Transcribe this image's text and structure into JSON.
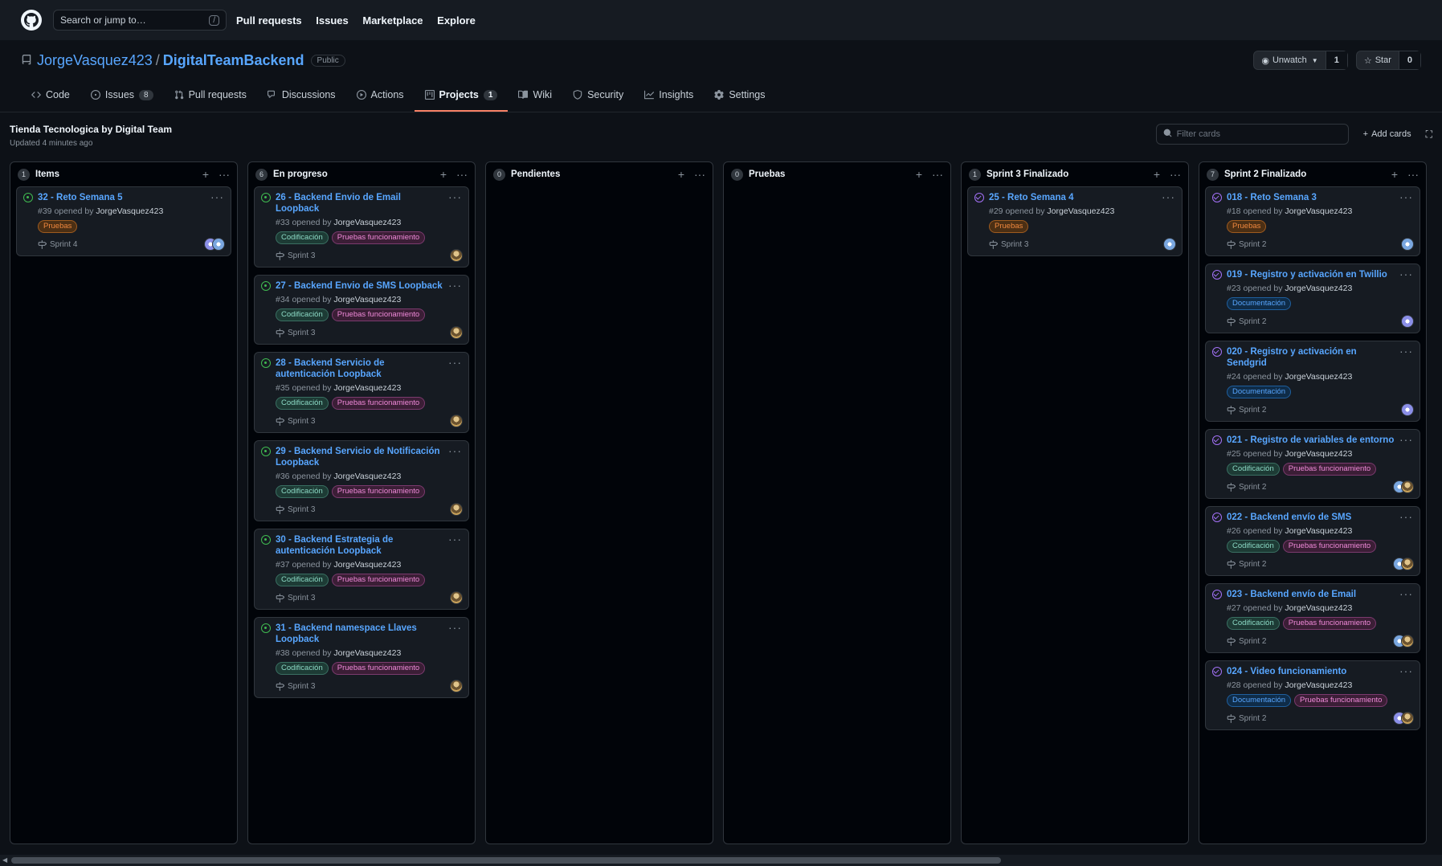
{
  "topbar": {
    "search_placeholder": "Search or jump to…",
    "search_key": "/",
    "nav": [
      "Pull requests",
      "Issues",
      "Marketplace",
      "Explore"
    ]
  },
  "repo": {
    "owner": "JorgeVasquez423",
    "name": "DigitalTeamBackend",
    "visibility": "Public",
    "watch_label": "Unwatch",
    "watch_count": "1",
    "star_label": "Star",
    "star_count": "0"
  },
  "tabs": [
    {
      "label": "Code",
      "icon": "code-icon"
    },
    {
      "label": "Issues",
      "icon": "issue-icon",
      "count": "8"
    },
    {
      "label": "Pull requests",
      "icon": "pull-request-icon"
    },
    {
      "label": "Discussions",
      "icon": "discussion-icon"
    },
    {
      "label": "Actions",
      "icon": "play-icon"
    },
    {
      "label": "Projects",
      "icon": "project-icon",
      "count": "1",
      "active": true
    },
    {
      "label": "Wiki",
      "icon": "book-icon"
    },
    {
      "label": "Security",
      "icon": "shield-icon"
    },
    {
      "label": "Insights",
      "icon": "graph-icon"
    },
    {
      "label": "Settings",
      "icon": "gear-icon"
    }
  ],
  "project": {
    "title": "Tienda Tecnologica by Digital Team",
    "updated": "Updated 4 minutes ago",
    "filter_placeholder": "Filter cards",
    "add_cards": "Add cards"
  },
  "columns": [
    {
      "name": "Items",
      "count": "1",
      "cards": [
        {
          "title": "32 - Reto Semana 5",
          "number": "#39",
          "opened_by": "opened by",
          "user": "JorgeVasquez423",
          "labels": [
            {
              "text": "Pruebas",
              "color": "orange"
            }
          ],
          "milestone": "Sprint 4",
          "state": "open",
          "avatars": [
            "purple",
            "blue"
          ]
        }
      ]
    },
    {
      "name": "En progreso",
      "count": "6",
      "cards": [
        {
          "title": "26 - Backend Envio de Email Loopback",
          "number": "#33",
          "opened_by": "opened by",
          "user": "JorgeVasquez423",
          "labels": [
            {
              "text": "Codificación",
              "color": "green"
            },
            {
              "text": "Pruebas funcionamiento",
              "color": "pink"
            }
          ],
          "milestone": "Sprint 3",
          "state": "open",
          "avatars": [
            "gold"
          ]
        },
        {
          "title": "27 - Backend Envio de SMS Loopback",
          "number": "#34",
          "opened_by": "opened by",
          "user": "JorgeVasquez423",
          "labels": [
            {
              "text": "Codificación",
              "color": "green"
            },
            {
              "text": "Pruebas funcionamiento",
              "color": "pink"
            }
          ],
          "milestone": "Sprint 3",
          "state": "open",
          "avatars": [
            "gold"
          ]
        },
        {
          "title": "28 - Backend Servicio de autenticación Loopback",
          "number": "#35",
          "opened_by": "opened by",
          "user": "JorgeVasquez423",
          "labels": [
            {
              "text": "Codificación",
              "color": "green"
            },
            {
              "text": "Pruebas funcionamiento",
              "color": "pink"
            }
          ],
          "milestone": "Sprint 3",
          "state": "open",
          "avatars": [
            "gold"
          ]
        },
        {
          "title": "29 - Backend Servicio de Notificación Loopback",
          "number": "#36",
          "opened_by": "opened by",
          "user": "JorgeVasquez423",
          "labels": [
            {
              "text": "Codificación",
              "color": "green"
            },
            {
              "text": "Pruebas funcionamiento",
              "color": "pink"
            }
          ],
          "milestone": "Sprint 3",
          "state": "open",
          "avatars": [
            "gold"
          ]
        },
        {
          "title": "30 - Backend Estrategia de autenticación Loopback",
          "number": "#37",
          "opened_by": "opened by",
          "user": "JorgeVasquez423",
          "labels": [
            {
              "text": "Codificación",
              "color": "green"
            },
            {
              "text": "Pruebas funcionamiento",
              "color": "pink"
            }
          ],
          "milestone": "Sprint 3",
          "state": "open",
          "avatars": [
            "gold"
          ]
        },
        {
          "title": "31 - Backend namespace Llaves Loopback",
          "number": "#38",
          "opened_by": "opened by",
          "user": "JorgeVasquez423",
          "labels": [
            {
              "text": "Codificación",
              "color": "green"
            },
            {
              "text": "Pruebas funcionamiento",
              "color": "pink"
            }
          ],
          "milestone": "Sprint 3",
          "state": "open",
          "avatars": [
            "gold"
          ]
        }
      ]
    },
    {
      "name": "Pendientes",
      "count": "0",
      "cards": []
    },
    {
      "name": "Pruebas",
      "count": "0",
      "cards": []
    },
    {
      "name": "Sprint 3 Finalizado",
      "count": "1",
      "cards": [
        {
          "title": "25 - Reto Semana 4",
          "number": "#29",
          "opened_by": "opened by",
          "user": "JorgeVasquez423",
          "labels": [
            {
              "text": "Pruebas",
              "color": "orange"
            }
          ],
          "milestone": "Sprint 3",
          "state": "closed",
          "avatars": [
            "blue"
          ]
        }
      ]
    },
    {
      "name": "Sprint 2 Finalizado",
      "count": "7",
      "cards": [
        {
          "title": "018 - Reto Semana 3",
          "number": "#18",
          "opened_by": "opened by",
          "user": "JorgeVasquez423",
          "labels": [
            {
              "text": "Pruebas",
              "color": "orange"
            }
          ],
          "milestone": "Sprint 2",
          "state": "closed",
          "avatars": [
            "blue"
          ]
        },
        {
          "title": "019 - Registro y activación en Twillio",
          "number": "#23",
          "opened_by": "opened by",
          "user": "JorgeVasquez423",
          "labels": [
            {
              "text": "Documentación",
              "color": "blue"
            }
          ],
          "milestone": "Sprint 2",
          "state": "closed",
          "avatars": [
            "purple"
          ]
        },
        {
          "title": "020 - Registro y activación en Sendgrid",
          "number": "#24",
          "opened_by": "opened by",
          "user": "JorgeVasquez423",
          "labels": [
            {
              "text": "Documentación",
              "color": "blue"
            }
          ],
          "milestone": "Sprint 2",
          "state": "closed",
          "avatars": [
            "purple"
          ]
        },
        {
          "title": "021 - Registro de variables de entorno",
          "number": "#25",
          "opened_by": "opened by",
          "user": "JorgeVasquez423",
          "labels": [
            {
              "text": "Codificación",
              "color": "green"
            },
            {
              "text": "Pruebas funcionamiento",
              "color": "pink"
            }
          ],
          "milestone": "Sprint 2",
          "state": "closed",
          "avatars": [
            "blue",
            "gold"
          ]
        },
        {
          "title": "022 - Backend envío de SMS",
          "number": "#26",
          "opened_by": "opened by",
          "user": "JorgeVasquez423",
          "labels": [
            {
              "text": "Codificación",
              "color": "green"
            },
            {
              "text": "Pruebas funcionamiento",
              "color": "pink"
            }
          ],
          "milestone": "Sprint 2",
          "state": "closed",
          "avatars": [
            "blue",
            "gold"
          ]
        },
        {
          "title": "023 - Backend envío de Email",
          "number": "#27",
          "opened_by": "opened by",
          "user": "JorgeVasquez423",
          "labels": [
            {
              "text": "Codificación",
              "color": "green"
            },
            {
              "text": "Pruebas funcionamiento",
              "color": "pink"
            }
          ],
          "milestone": "Sprint 2",
          "state": "closed",
          "avatars": [
            "blue",
            "gold"
          ]
        },
        {
          "title": "024 - Video funcionamiento",
          "number": "#28",
          "opened_by": "opened by",
          "user": "JorgeVasquez423",
          "labels": [
            {
              "text": "Documentación",
              "color": "blue"
            },
            {
              "text": "Pruebas funcionamiento",
              "color": "pink"
            }
          ],
          "milestone": "Sprint 2",
          "state": "closed",
          "avatars": [
            "purple",
            "gold"
          ]
        }
      ]
    }
  ]
}
